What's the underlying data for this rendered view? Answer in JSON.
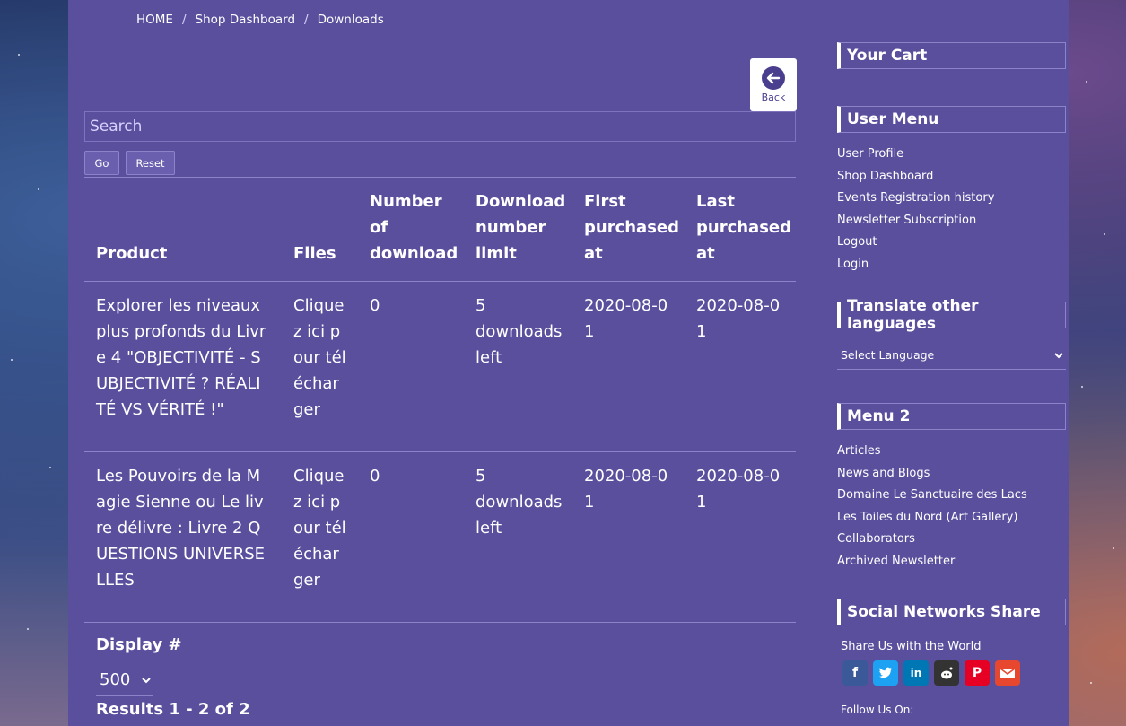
{
  "breadcrumb": {
    "home": "HOME",
    "sep1": "/",
    "shop": "Shop Dashboard",
    "sep2": "/",
    "current": "Downloads"
  },
  "back_label": "Back",
  "search": {
    "placeholder": "Search"
  },
  "buttons": {
    "go": "Go",
    "reset": "Reset"
  },
  "table": {
    "headers": [
      "Product",
      "Files",
      "Number of download",
      "Download number limit",
      "First purchased at",
      "Last purchased at"
    ],
    "rows": [
      {
        "product": "Explorer les niveaux plus profonds du Livre 4 \"OBJECTIVITÉ - SUBJECTIVITÉ ? RÉALITÉ VS VÉRITÉ !\"",
        "files": "Cliquez ici pour télécharger",
        "downloads": "0",
        "limit": "5 downloads left",
        "first": "2020-08-01",
        "last": "2020-08-01"
      },
      {
        "product": "Les Pouvoirs de la Magie Sienne ou Le livre délivre : Livre 2 QUESTIONS UNIVERSELLES",
        "files": "Cliquez ici pour télécharger",
        "downloads": "0",
        "limit": "5 downloads left",
        "first": "2020-08-01",
        "last": "2020-08-01"
      }
    ]
  },
  "pagination": {
    "display_label": "Display #",
    "display_value": "500",
    "results": "Results 1 - 2 of 2"
  },
  "sidebar": {
    "cart_title": "Your Cart",
    "user_menu_title": "User Menu",
    "user_menu": [
      "User Profile",
      "Shop Dashboard",
      "Events Registration history",
      "Newsletter Subscription",
      "Logout",
      "Login"
    ],
    "translate_title": "Translate other languages",
    "language_select": "Select Language",
    "menu2_title": "Menu 2",
    "menu2": [
      "Articles",
      "News and Blogs",
      "Domaine Le Sanctuaire des Lacs",
      "Les Toiles du Nord (Art Gallery)",
      "Collaborators",
      "Archived Newsletter"
    ],
    "social_title": "Social Networks Share",
    "share_text": "Share Us with the World",
    "share_icons": [
      "facebook-icon",
      "twitter-icon",
      "linkedin-icon",
      "reddit-icon",
      "pinterest-icon",
      "email-icon"
    ],
    "follow_text": "Follow Us On:"
  },
  "colors": {
    "panel": "#5a4f9d",
    "border": "#8d83c9",
    "text": "#ffffff"
  }
}
